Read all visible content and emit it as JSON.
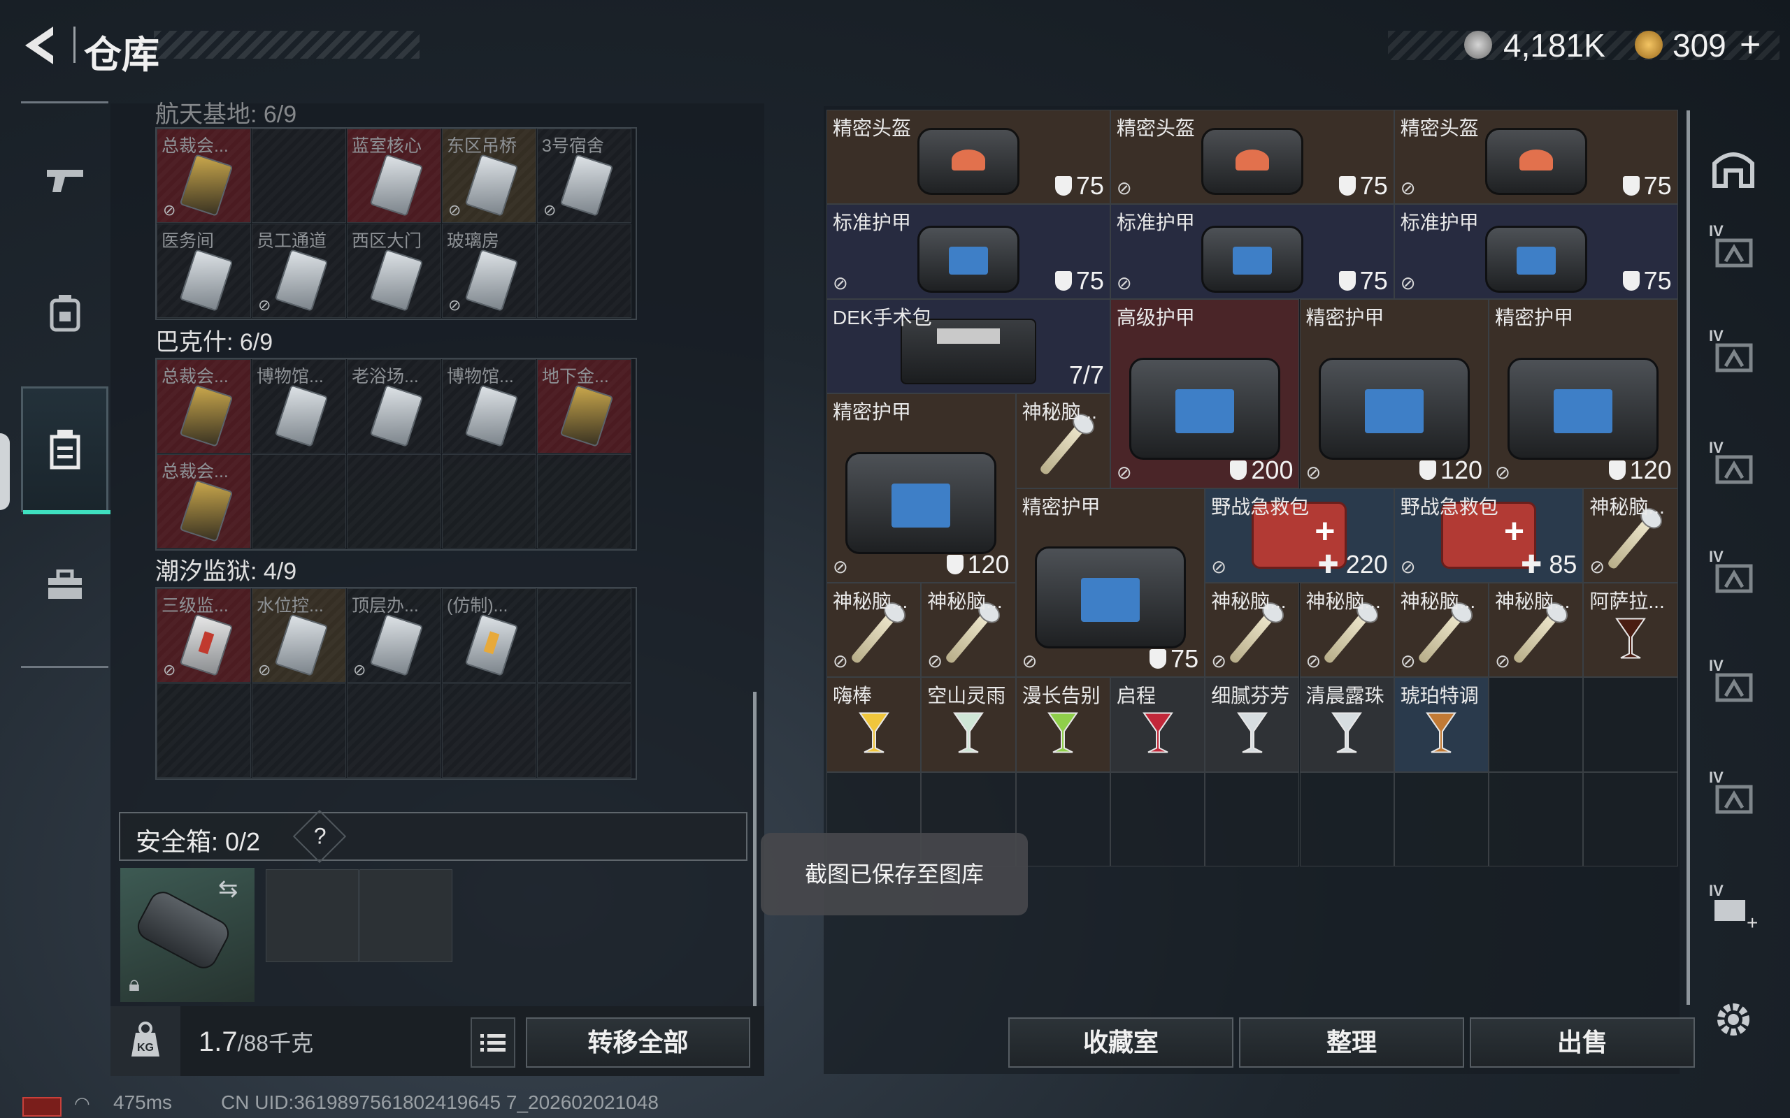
{
  "header": {
    "title": "仓库",
    "currency_silver": "4,181K",
    "currency_gold": "309",
    "currency_gold_add": "+"
  },
  "left_nav": {
    "items": [
      {
        "icon": "gun-icon"
      },
      {
        "icon": "backpack-icon"
      },
      {
        "icon": "container-icon",
        "active": true
      },
      {
        "icon": "toolbox-icon"
      }
    ]
  },
  "left_panel": {
    "sections": [
      {
        "title": "航天基地: 6/9",
        "rows": [
          [
            {
              "label": "总裁会...",
              "bg": "red",
              "card": "gold",
              "lock": true
            },
            {
              "label": "",
              "bg": "dark"
            },
            {
              "label": "蓝室核心",
              "bg": "red",
              "card": "silver"
            },
            {
              "label": "东区吊桥",
              "bg": "brown",
              "card": "silver",
              "lock": true
            },
            {
              "label": "3号宿舍",
              "bg": "dark",
              "card": "silver",
              "lock": true
            }
          ],
          [
            {
              "label": "医务间",
              "bg": "dark",
              "card": "silver"
            },
            {
              "label": "员工通道",
              "bg": "dark",
              "card": "silver",
              "lock": true
            },
            {
              "label": "西区大门",
              "bg": "dark",
              "card": "silver"
            },
            {
              "label": "玻璃房",
              "bg": "dark",
              "card": "silver",
              "lock": true
            },
            {
              "label": "",
              "bg": "dark"
            }
          ]
        ]
      },
      {
        "title": "巴克什: 6/9",
        "rows": [
          [
            {
              "label": "总裁会...",
              "bg": "red",
              "card": "gold"
            },
            {
              "label": "博物馆...",
              "bg": "dark",
              "card": "silver"
            },
            {
              "label": "老浴场...",
              "bg": "dark",
              "card": "silver"
            },
            {
              "label": "博物馆...",
              "bg": "dark",
              "card": "silver"
            },
            {
              "label": "地下金...",
              "bg": "red",
              "card": "gold"
            }
          ],
          [
            {
              "label": "总裁会...",
              "bg": "red",
              "card": "gold"
            },
            {
              "label": "",
              "bg": "dark"
            },
            {
              "label": "",
              "bg": "dark"
            },
            {
              "label": "",
              "bg": "dark"
            },
            {
              "label": "",
              "bg": "dark"
            }
          ]
        ]
      },
      {
        "title": "潮汐监狱: 4/9",
        "rows": [
          [
            {
              "label": "三级监...",
              "bg": "red",
              "card": "red",
              "lock": true
            },
            {
              "label": "水位控...",
              "bg": "brown",
              "card": "silver",
              "lock": true
            },
            {
              "label": "顶层办...",
              "bg": "dark",
              "card": "silver",
              "lock": true
            },
            {
              "label": "(仿制)...",
              "bg": "dark",
              "card": "ylw"
            },
            {
              "label": "",
              "bg": "dark"
            }
          ],
          [
            {
              "label": "",
              "bg": "dark"
            },
            {
              "label": "",
              "bg": "dark"
            },
            {
              "label": "",
              "bg": "dark"
            },
            {
              "label": "",
              "bg": "dark"
            },
            {
              "label": "",
              "bg": "dark"
            }
          ]
        ]
      }
    ],
    "safebox": {
      "label": "安全箱: 0/2",
      "help": "?"
    },
    "weight": {
      "value": "1.7",
      "total": "/88千克"
    },
    "transfer_all": "转移全部"
  },
  "toast": "截图已保存至图库",
  "inventory": [
    {
      "name": "精密头盔",
      "type": "helmet",
      "tone": "brown",
      "value": "75",
      "vtype": "armor",
      "nodrop": false,
      "c": 0,
      "r": 0,
      "w": 3,
      "h": 1
    },
    {
      "name": "精密头盔",
      "type": "helmet",
      "tone": "brown",
      "value": "75",
      "vtype": "armor",
      "nodrop": true,
      "c": 3,
      "r": 0,
      "w": 3,
      "h": 1
    },
    {
      "name": "精密头盔",
      "type": "helmet",
      "tone": "brown",
      "value": "75",
      "vtype": "armor",
      "nodrop": true,
      "c": 6,
      "r": 0,
      "w": 3,
      "h": 1
    },
    {
      "name": "标准护甲",
      "type": "armor",
      "tone": "blue",
      "value": "75",
      "vtype": "armor",
      "nodrop": true,
      "c": 0,
      "r": 1,
      "w": 3,
      "h": 1
    },
    {
      "name": "标准护甲",
      "type": "armor",
      "tone": "blue",
      "value": "75",
      "vtype": "armor",
      "nodrop": true,
      "c": 3,
      "r": 1,
      "w": 3,
      "h": 1
    },
    {
      "name": "标准护甲",
      "type": "armor",
      "tone": "blue",
      "value": "75",
      "vtype": "armor",
      "nodrop": true,
      "c": 6,
      "r": 1,
      "w": 3,
      "h": 1
    },
    {
      "name": "DEK手术包",
      "type": "surgery",
      "tone": "blue",
      "value": "7/7",
      "vtype": "plain",
      "nodrop": false,
      "c": 0,
      "r": 2,
      "w": 3,
      "h": 1
    },
    {
      "name": "高级护甲",
      "type": "armor",
      "tone": "red",
      "value": "200",
      "vtype": "armor",
      "nodrop": true,
      "c": 3,
      "r": 2,
      "w": 2,
      "h": 2
    },
    {
      "name": "精密护甲",
      "type": "armor",
      "tone": "brown",
      "value": "120",
      "vtype": "armor",
      "nodrop": true,
      "c": 5,
      "r": 2,
      "w": 2,
      "h": 2
    },
    {
      "name": "精密护甲",
      "type": "armor",
      "tone": "brown",
      "value": "120",
      "vtype": "armor",
      "nodrop": true,
      "c": 7,
      "r": 2,
      "w": 2,
      "h": 2
    },
    {
      "name": "精密护甲",
      "type": "armor",
      "tone": "brown",
      "value": "120",
      "vtype": "armor",
      "nodrop": true,
      "c": 0,
      "r": 3,
      "w": 2,
      "h": 2
    },
    {
      "name": "神秘脑...",
      "type": "syringe",
      "tone": "brown",
      "value": "",
      "vtype": "plain",
      "nodrop": false,
      "c": 2,
      "r": 3,
      "w": 1,
      "h": 1
    },
    {
      "name": "精密护甲",
      "type": "armor",
      "tone": "brown",
      "value": "75",
      "vtype": "armor",
      "nodrop": true,
      "c": 2,
      "r": 4,
      "w": 2,
      "h": 2
    },
    {
      "name": "野战急救包",
      "type": "medkit",
      "tone": "bluegrey",
      "value": "220",
      "vtype": "heal",
      "nodrop": true,
      "c": 4,
      "r": 4,
      "w": 2,
      "h": 1
    },
    {
      "name": "野战急救包",
      "type": "medkit",
      "tone": "bluegrey",
      "value": "85",
      "vtype": "heal",
      "nodrop": true,
      "c": 6,
      "r": 4,
      "w": 2,
      "h": 1
    },
    {
      "name": "神秘脑...",
      "type": "syringe",
      "tone": "brown",
      "value": "",
      "vtype": "plain",
      "nodrop": true,
      "c": 8,
      "r": 4,
      "w": 1,
      "h": 1
    },
    {
      "name": "神秘脑...",
      "type": "syringe",
      "tone": "brown",
      "value": "",
      "vtype": "plain",
      "nodrop": true,
      "c": 0,
      "r": 5,
      "w": 1,
      "h": 1
    },
    {
      "name": "神秘脑...",
      "type": "syringe",
      "tone": "brown",
      "value": "",
      "vtype": "plain",
      "nodrop": true,
      "c": 1,
      "r": 5,
      "w": 1,
      "h": 1
    },
    {
      "name": "神秘脑...",
      "type": "syringe",
      "tone": "brown",
      "value": "",
      "vtype": "plain",
      "nodrop": true,
      "c": 4,
      "r": 5,
      "w": 1,
      "h": 1
    },
    {
      "name": "神秘脑...",
      "type": "syringe",
      "tone": "brown",
      "value": "",
      "vtype": "plain",
      "nodrop": true,
      "c": 5,
      "r": 5,
      "w": 1,
      "h": 1
    },
    {
      "name": "神秘脑...",
      "type": "syringe",
      "tone": "brown",
      "value": "",
      "vtype": "plain",
      "nodrop": true,
      "c": 6,
      "r": 5,
      "w": 1,
      "h": 1
    },
    {
      "name": "神秘脑...",
      "type": "syringe",
      "tone": "brown",
      "value": "",
      "vtype": "plain",
      "nodrop": true,
      "c": 7,
      "r": 5,
      "w": 1,
      "h": 1
    },
    {
      "name": "阿萨拉...",
      "type": "glass-cola",
      "tone": "brown",
      "value": "",
      "vtype": "plain",
      "nodrop": false,
      "c": 8,
      "r": 5,
      "w": 1,
      "h": 1
    },
    {
      "name": "嗨棒",
      "type": "glass-yellow",
      "tone": "brown",
      "value": "",
      "vtype": "plain",
      "nodrop": false,
      "c": 0,
      "r": 6,
      "w": 1,
      "h": 1
    },
    {
      "name": "空山灵雨",
      "type": "glass-clear",
      "tone": "brown",
      "value": "",
      "vtype": "plain",
      "nodrop": false,
      "c": 1,
      "r": 6,
      "w": 1,
      "h": 1
    },
    {
      "name": "漫长告别",
      "type": "glass-green",
      "tone": "brown",
      "value": "",
      "vtype": "plain",
      "nodrop": false,
      "c": 2,
      "r": 6,
      "w": 1,
      "h": 1
    },
    {
      "name": "启程",
      "type": "glass-red",
      "tone": "gray",
      "value": "",
      "vtype": "plain",
      "nodrop": false,
      "c": 3,
      "r": 6,
      "w": 1,
      "h": 1
    },
    {
      "name": "细腻芬芳",
      "type": "glass-rock",
      "tone": "gray",
      "value": "",
      "vtype": "plain",
      "nodrop": false,
      "c": 4,
      "r": 6,
      "w": 1,
      "h": 1
    },
    {
      "name": "清晨露珠",
      "type": "glass-rock",
      "tone": "gray",
      "value": "",
      "vtype": "plain",
      "nodrop": false,
      "c": 5,
      "r": 6,
      "w": 1,
      "h": 1
    },
    {
      "name": "琥珀特调",
      "type": "glass-amber",
      "tone": "bluegrey",
      "value": "",
      "vtype": "plain",
      "nodrop": false,
      "c": 6,
      "r": 6,
      "w": 1,
      "h": 1
    }
  ],
  "right_icons": [
    {
      "name": "home-base-icon",
      "badge": ""
    },
    {
      "name": "case-tier-4-icon",
      "badge": "IV"
    },
    {
      "name": "case-tier-4-icon",
      "badge": "IV"
    },
    {
      "name": "case-tier-4-icon",
      "badge": "IV"
    },
    {
      "name": "case-tier-4-icon",
      "badge": "IV"
    },
    {
      "name": "case-tier-4-icon",
      "badge": "IV"
    },
    {
      "name": "case-tier-4-icon",
      "badge": "IV"
    },
    {
      "name": "add-case-icon",
      "badge": "IV"
    },
    {
      "name": "gear-icon",
      "badge": ""
    }
  ],
  "bottom_buttons": {
    "collection": "收藏室",
    "sort": "整理",
    "sell": "出售"
  },
  "status": {
    "ping": "475ms",
    "uid": "CN UID:3619897561802419645 7_202602021048"
  }
}
